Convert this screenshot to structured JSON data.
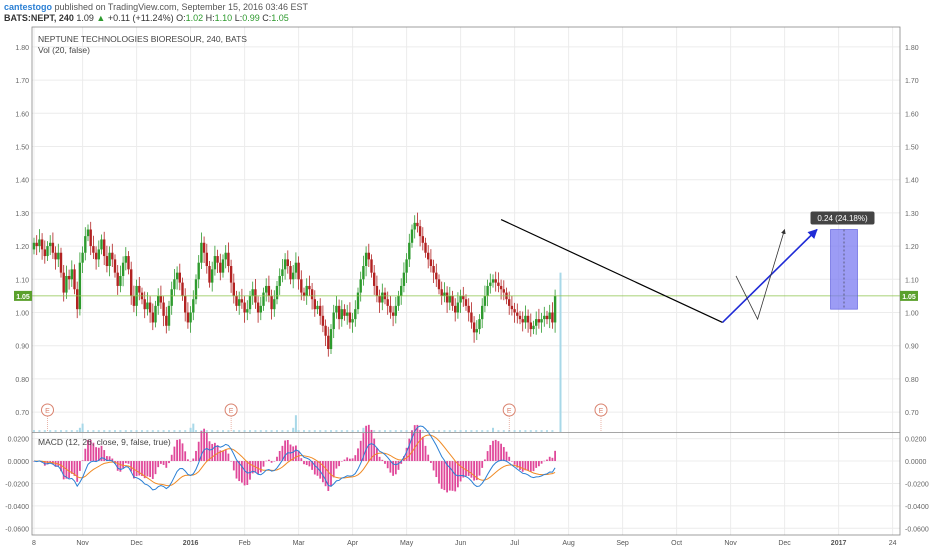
{
  "header": {
    "author": "cantestogo",
    "published": "published on TradingView.com, September 15, 2016 03:46 EST",
    "symbol": "BATS:NEPT, 240",
    "last": "1.09",
    "change": "+0.11 (+11.24%)",
    "o_label": "O:",
    "o_value": "1.02",
    "h_label": "H:",
    "h_value": "1.10",
    "l_label": "L:",
    "l_value": "0.99",
    "c_label": "C:",
    "c_value": "1.05"
  },
  "chart_data": [
    {
      "type": "candlestick",
      "title": "NEPTUNE TECHNOLOGIES BIORESOUR, 240, BATS",
      "subtitle": "Vol (20, false)",
      "ylim": [
        0.64,
        1.86
      ],
      "yticks": [
        "1.80",
        "1.70",
        "1.60",
        "1.50",
        "1.40",
        "1.30",
        "1.20",
        "1.10",
        "1.00",
        "0.90",
        "0.80",
        "0.70"
      ],
      "ytick_values": [
        1.8,
        1.7,
        1.6,
        1.5,
        1.4,
        1.3,
        1.2,
        1.1,
        1.0,
        0.9,
        0.8,
        0.7
      ],
      "x_labels": [
        "8",
        "Nov",
        "Dec",
        "2016",
        "Feb",
        "Mar",
        "Apr",
        "May",
        "Jun",
        "Jul",
        "Aug",
        "Sep",
        "Oct",
        "Nov",
        "Dec",
        "2017",
        "24"
      ],
      "x_label_bars": [
        0,
        18,
        38,
        58,
        78,
        98,
        118,
        138,
        158,
        178,
        198,
        218,
        238,
        258,
        278,
        298,
        318
      ],
      "last_price_label": "1.05",
      "last_price": 1.05,
      "close_series": [
        1.21,
        1.2,
        1.22,
        1.19,
        1.17,
        1.2,
        1.21,
        1.18,
        1.16,
        1.18,
        1.12,
        1.06,
        1.11,
        1.1,
        1.13,
        1.07,
        1.01,
        1.15,
        1.18,
        1.23,
        1.25,
        1.2,
        1.18,
        1.16,
        1.19,
        1.22,
        1.17,
        1.14,
        1.18,
        1.16,
        1.12,
        1.08,
        1.11,
        1.15,
        1.17,
        1.13,
        1.05,
        1.02,
        1.08,
        1.06,
        1.04,
        1.01,
        1.03,
        1.0,
        0.97,
        1.02,
        1.05,
        1.03,
        0.99,
        0.96,
        1.02,
        1.07,
        1.1,
        1.12,
        1.09,
        1.05,
        1.0,
        0.97,
        1.0,
        1.04,
        1.1,
        1.15,
        1.21,
        1.18,
        1.14,
        1.09,
        1.13,
        1.17,
        1.15,
        1.12,
        1.16,
        1.18,
        1.14,
        1.09,
        1.05,
        1.02,
        1.04,
        1.03,
        1.0,
        1.01,
        1.05,
        1.07,
        1.03,
        1.0,
        1.02,
        1.06,
        1.08,
        1.05,
        1.01,
        1.04,
        1.08,
        1.11,
        1.13,
        1.16,
        1.14,
        1.1,
        1.12,
        1.15,
        1.1,
        1.06,
        1.05,
        1.08,
        1.07,
        1.04,
        1.01,
        1.02,
        0.99,
        0.96,
        0.93,
        0.89,
        0.95,
        1.0,
        1.02,
        0.98,
        1.01,
        0.99,
        1.0,
        0.97,
        0.98,
        1.01,
        1.06,
        1.1,
        1.14,
        1.18,
        1.16,
        1.12,
        1.08,
        1.05,
        1.03,
        1.06,
        1.04,
        1.02,
        1.0,
        0.99,
        1.02,
        1.05,
        1.08,
        1.12,
        1.16,
        1.21,
        1.25,
        1.27,
        1.26,
        1.23,
        1.21,
        1.18,
        1.16,
        1.14,
        1.12,
        1.1,
        1.07,
        1.05,
        1.06,
        1.03,
        1.05,
        1.02,
        1.0,
        1.03,
        1.05,
        1.04,
        1.02,
        1.0,
        0.97,
        0.94,
        0.95,
        0.98,
        1.02,
        1.05,
        1.08,
        1.09,
        1.1,
        1.09,
        1.08,
        1.07,
        1.06,
        1.04,
        1.02,
        1.01,
        1.0,
        0.99,
        0.98,
        0.97,
        0.99,
        0.97,
        0.95,
        0.96,
        0.98,
        0.97,
        0.98,
        0.99,
        0.98,
        1.0,
        0.97,
        1.05
      ],
      "volume": [
        0,
        0,
        0,
        0,
        0,
        0,
        0,
        0,
        0,
        0,
        0,
        0,
        0,
        0,
        0,
        0,
        0,
        0.01,
        0.02,
        0,
        0,
        0,
        0,
        0,
        0,
        0,
        0,
        0,
        0,
        0,
        0,
        0,
        0,
        0,
        0,
        0,
        0,
        0,
        0,
        0,
        0,
        0,
        0,
        0,
        0,
        0,
        0,
        0,
        0,
        0,
        0,
        0,
        0,
        0,
        0,
        0,
        0,
        0,
        0.01,
        0.02,
        0,
        0,
        0,
        0,
        0,
        0,
        0,
        0,
        0,
        0,
        0,
        0,
        0,
        0,
        0,
        0,
        0,
        0,
        0,
        0,
        0,
        0,
        0,
        0,
        0,
        0,
        0,
        0,
        0,
        0,
        0,
        0,
        0,
        0,
        0,
        0,
        0.01,
        0.04,
        0,
        0,
        0,
        0,
        0,
        0,
        0,
        0,
        0,
        0,
        0,
        0,
        0,
        0,
        0,
        0,
        0,
        0,
        0,
        0,
        0,
        0,
        0,
        0,
        0.01,
        0,
        0,
        0,
        0,
        0,
        0,
        0,
        0,
        0,
        0,
        0,
        0,
        0,
        0,
        0,
        0,
        0,
        0,
        0,
        0,
        0,
        0,
        0,
        0,
        0,
        0,
        0,
        0,
        0,
        0,
        0,
        0,
        0,
        0,
        0,
        0,
        0,
        0,
        0,
        0,
        0,
        0,
        0,
        0,
        0,
        0,
        0,
        0.01,
        0,
        0,
        0,
        0,
        0,
        0,
        0,
        0,
        0,
        0,
        0,
        0,
        0,
        0,
        0,
        0,
        0,
        0,
        0,
        0,
        0,
        0,
        0,
        0,
        0.38
      ],
      "earnings_markers": [
        {
          "label": "E",
          "bar": 5
        },
        {
          "label": "E",
          "bar": 73
        },
        {
          "label": "E",
          "bar": 176
        },
        {
          "label": "E",
          "bar": 210
        }
      ],
      "trendline": {
        "start": {
          "bar": 173,
          "price": 1.28
        },
        "end": {
          "bar": 255,
          "price": 0.97
        }
      },
      "projection_arrows": [
        {
          "start": {
            "bar": 255,
            "price": 0.97
          },
          "end": {
            "bar": 290,
            "price": 1.25
          }
        },
        {
          "start": {
            "bar": 262,
            "price": 1.07
          },
          "end": {
            "bar": 268,
            "price": 1.04
          }
        }
      ],
      "measure_box": {
        "label": "0.24 (24.18%)",
        "bar_start": 295,
        "bar_end": 305,
        "price_low": 1.01,
        "price_high": 1.25
      }
    },
    {
      "type": "line",
      "title": "MACD (12, 26, close, 9, false, true)",
      "ylim": [
        -0.066,
        0.025
      ],
      "yticks": [
        "0.0200",
        "0.0000",
        "-0.0200",
        "-0.0400",
        "-0.0600"
      ],
      "ytick_values": [
        0.02,
        0,
        -0.02,
        -0.04,
        -0.06
      ],
      "series": [
        {
          "role": "macd",
          "color": "#2a7fd4"
        },
        {
          "role": "signal",
          "color": "#f08a24"
        },
        {
          "role": "histogram",
          "color": "#e0489a"
        }
      ]
    }
  ],
  "colors": {
    "up": "#2d9a2d",
    "down": "#b22222",
    "grid": "#ececec",
    "axis": "#888888",
    "trend": "#000000",
    "arrow": "#1f2bd6",
    "box": "#7b7bf2",
    "vol": "#a8d8e8",
    "price_line": "#8bc34a",
    "earnings": "#d9826e"
  }
}
